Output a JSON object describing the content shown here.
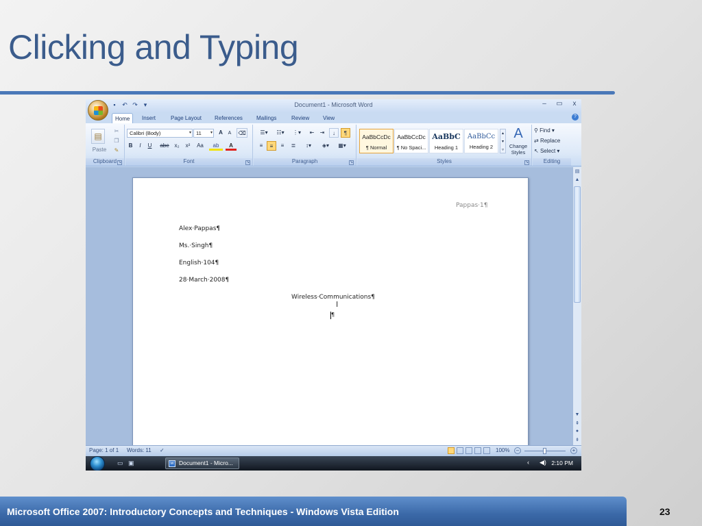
{
  "slide": {
    "title": "Clicking and Typing",
    "footer": "Microsoft Office 2007: Introductory Concepts and Techniques - Windows Vista Edition",
    "page_number": "23"
  },
  "window": {
    "title": "Document1 - Microsoft Word",
    "controls": {
      "minimize": "–",
      "maximize": "▭",
      "close": "x"
    }
  },
  "tabs": [
    "Home",
    "Insert",
    "Page Layout",
    "References",
    "Mailings",
    "Review",
    "View"
  ],
  "ribbon": {
    "clipboard": {
      "label": "Clipboard",
      "paste": "Paste"
    },
    "font": {
      "label": "Font",
      "font_name": "Calibri (Body)",
      "font_size": "11",
      "bold": "B",
      "italic": "I",
      "underline": "U",
      "strike": "abe",
      "subscript": "x₂",
      "superscript": "x²",
      "case": "Aa",
      "grow": "A",
      "shrink": "A"
    },
    "paragraph": {
      "label": "Paragraph",
      "show_marks": "¶"
    },
    "styles": {
      "label": "Styles",
      "items": [
        {
          "sample": "AaBbCcDc",
          "name": "¶ Normal"
        },
        {
          "sample": "AaBbCcDc",
          "name": "¶ No Spaci..."
        },
        {
          "sample": "AaBbC",
          "name": "Heading 1"
        },
        {
          "sample": "AaBbCc",
          "name": "Heading 2"
        }
      ],
      "change_styles": "Change Styles"
    },
    "editing": {
      "label": "Editing",
      "find": "Find",
      "replace": "Replace",
      "select": "Select"
    }
  },
  "document": {
    "header": "Pappas·1¶",
    "lines": [
      "Alex·Pappas¶",
      "Ms.·Singh¶",
      "English·104¶",
      "28·March·2008¶"
    ],
    "centered_title": "Wireless·Communications¶",
    "cursor_mark": "¶"
  },
  "status": {
    "page": "Page: 1 of 1",
    "words": "Words: 11",
    "zoom": "100%"
  },
  "taskbar": {
    "task": "Document1 - Micro...",
    "clock": "2:10 PM"
  }
}
